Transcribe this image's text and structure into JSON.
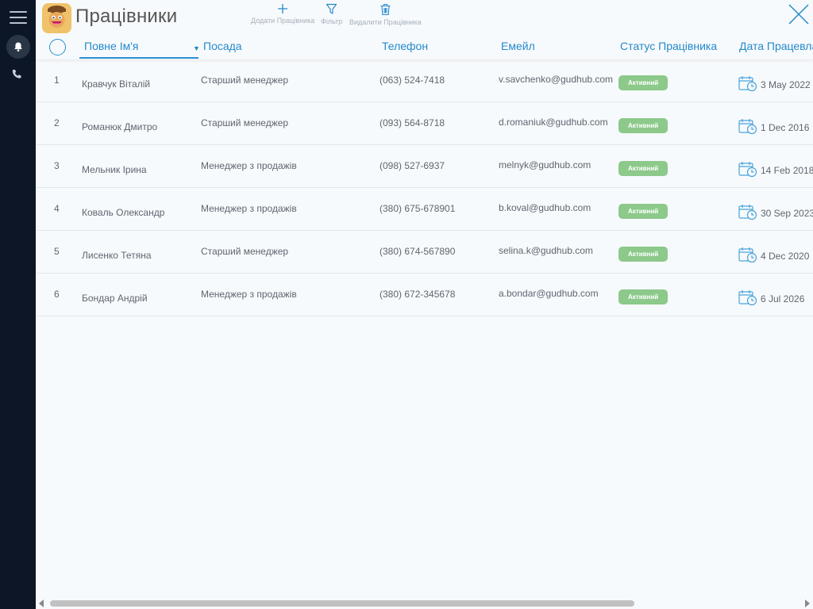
{
  "header": {
    "title": "Працівники",
    "tools": {
      "add_label": "Додати Працівника",
      "filter_label": "Фільтр",
      "delete_label": "Видалити Працівника"
    }
  },
  "columns": {
    "name": "Повне Ім'я",
    "position": "Посада",
    "phone": "Телефон",
    "email": "Емейл",
    "status": "Статус Працівника",
    "date": "Дата Працевлаштування"
  },
  "rows": [
    {
      "num": "1",
      "name": "Кравчук Віталій",
      "position": "Старший менеджер",
      "phone": "(063) 524-7418",
      "email": "v.savchenko@gudhub.com",
      "status": "Активний",
      "date": "3 May 2022"
    },
    {
      "num": "2",
      "name": "Романюк Дмитро",
      "position": "Старший менеджер",
      "phone": "(093) 564-8718",
      "email": "d.romaniuk@gudhub.com",
      "status": "Активний",
      "date": "1 Dec 2016"
    },
    {
      "num": "3",
      "name": "Мельник Ірина",
      "position": "Менеджер з продажів",
      "phone": "(098) 527-6937",
      "email": "melnyk@gudhub.com",
      "status": "Активний",
      "date": "14 Feb 2018"
    },
    {
      "num": "4",
      "name": "Коваль Олександр",
      "position": "Менеджер з продажів",
      "phone": "(380) 675-678901",
      "email": "b.koval@gudhub.com",
      "status": "Активний",
      "date": "30 Sep 2023"
    },
    {
      "num": "5",
      "name": "Лисенко Тетяна",
      "position": "Старший менеджер",
      "phone": "(380) 674-567890",
      "email": "selina.k@gudhub.com",
      "status": "Активний",
      "date": "4 Dec 2020"
    },
    {
      "num": "6",
      "name": "Бондар Андрій",
      "position": "Менеджер з продажів",
      "phone": "(380) 672-345678",
      "email": "a.bondar@gudhub.com",
      "status": "Активний",
      "date": "6 Jul 2026"
    }
  ],
  "colors": {
    "rail": "#0c1626",
    "accent": "#2589cc",
    "status_active": "#8cc98a",
    "background": "#f7fafc"
  },
  "icons": {
    "menu": "hamburger-icon",
    "bell": "bell-icon",
    "phone": "phone-icon",
    "add": "plus-icon",
    "filter": "filter-icon",
    "delete": "trash-icon",
    "close": "close-icon",
    "date": "calendar-clock-icon"
  }
}
